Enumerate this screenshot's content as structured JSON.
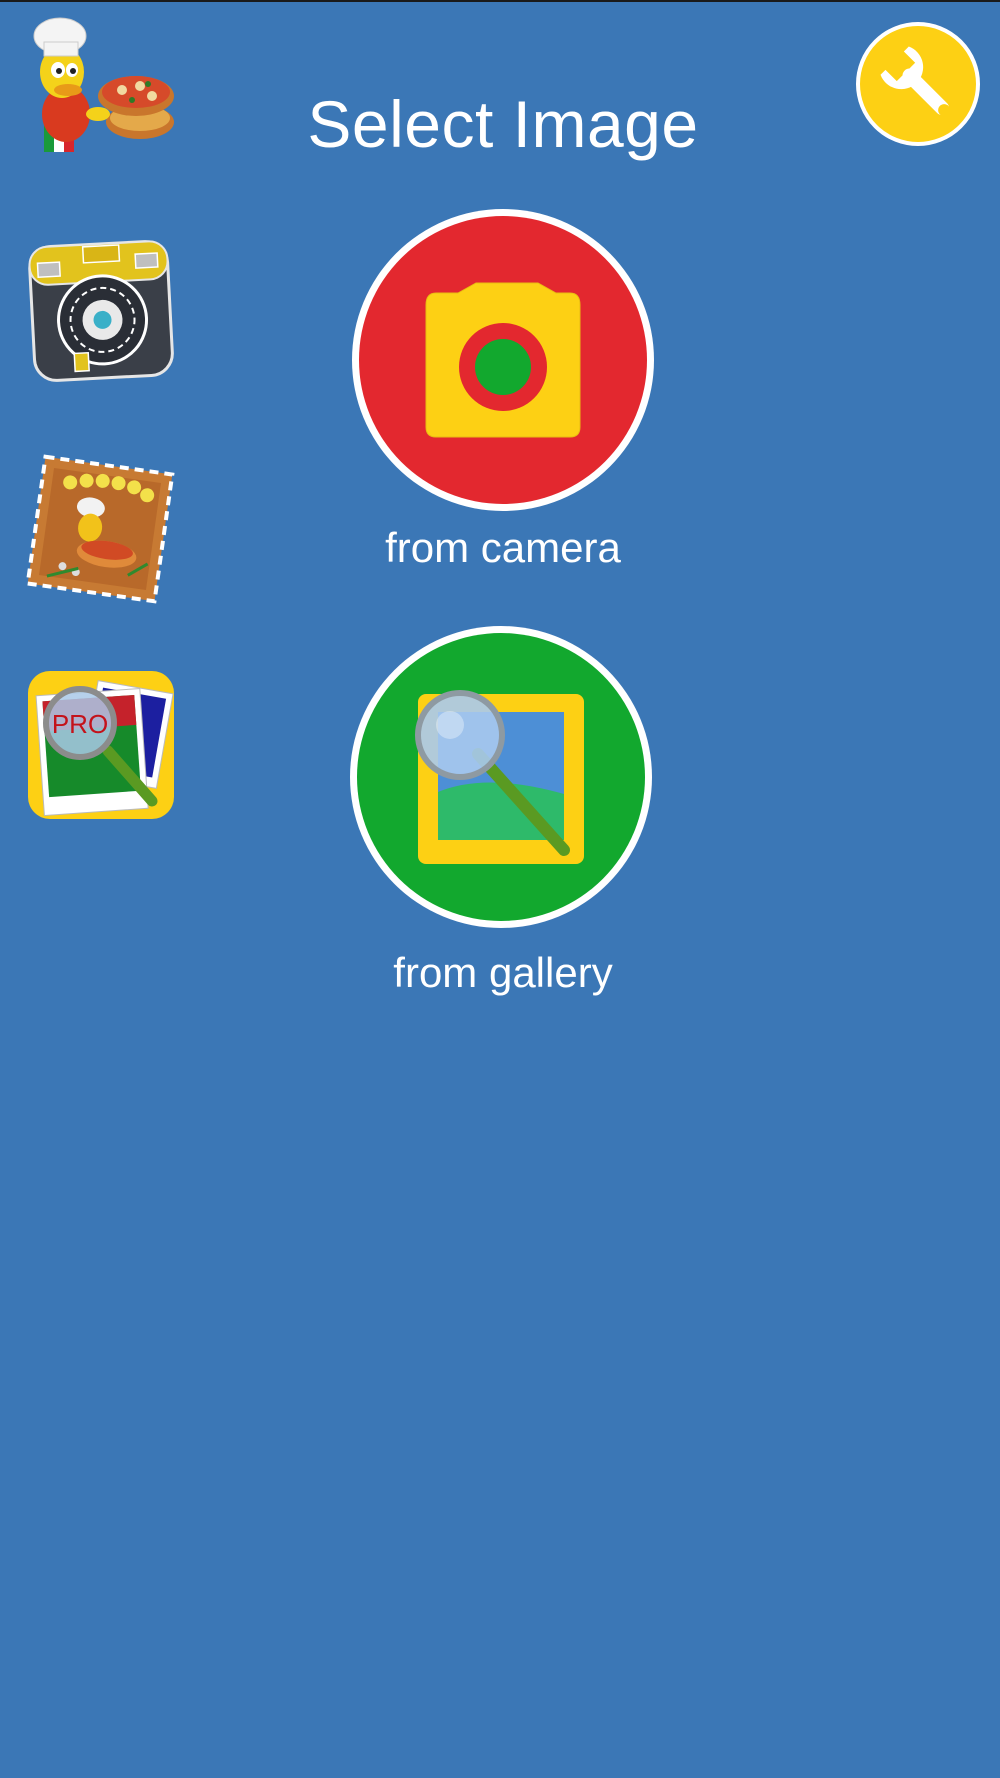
{
  "header": {
    "title": "Select Image"
  },
  "side_apps": [
    {
      "icon": "pizza-chef-app-icon"
    },
    {
      "icon": "sketch-camera-app-icon"
    },
    {
      "icon": "pizza-pinball-app-icon"
    },
    {
      "icon": "photo-search-pro-app-icon",
      "badge_text": "PRO"
    }
  ],
  "settings": {
    "icon": "wrench-icon"
  },
  "actions": {
    "camera": {
      "label": "from camera",
      "icon": "camera-icon"
    },
    "gallery": {
      "label": "from gallery",
      "icon": "gallery-magnifier-icon"
    }
  },
  "colors": {
    "background": "#3b77b6",
    "camera_circle": "#e3282f",
    "gallery_circle": "#12a82e",
    "accent_yellow": "#fdd014"
  }
}
